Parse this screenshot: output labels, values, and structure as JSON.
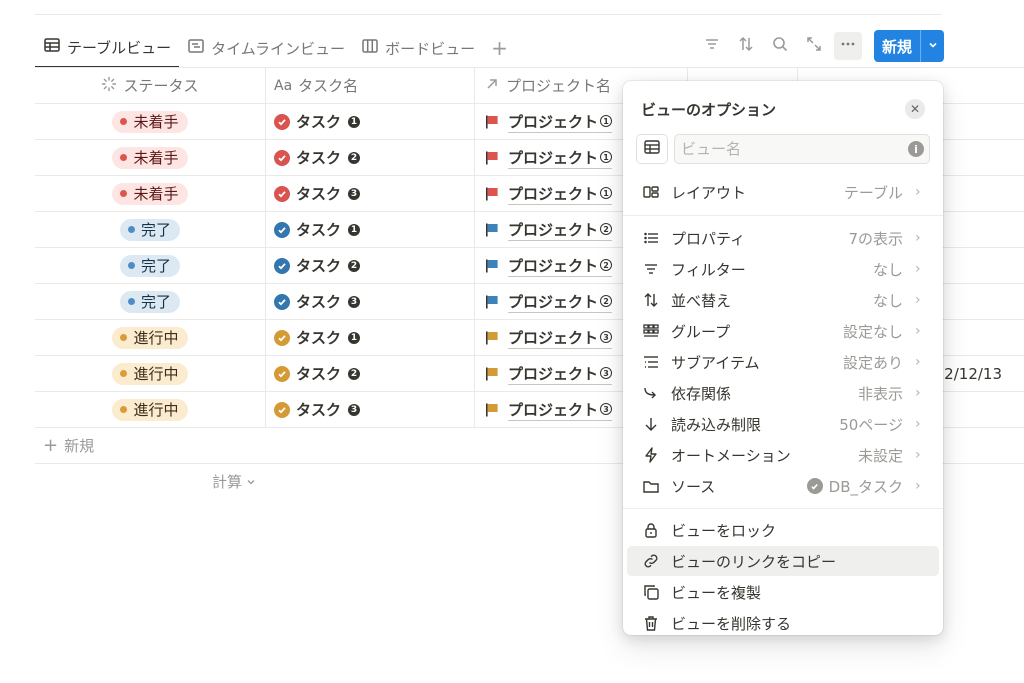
{
  "tabs": [
    {
      "label": "テーブルビュー",
      "icon": "table-icon",
      "active": true
    },
    {
      "label": "タイムラインビュー",
      "icon": "timeline-icon",
      "active": false
    },
    {
      "label": "ボードビュー",
      "icon": "board-icon",
      "active": false
    }
  ],
  "tab_add": "+",
  "toolbar": {
    "icons": [
      "filter-icon",
      "sort-icon",
      "search-icon",
      "expand-icon",
      "more-icon"
    ],
    "new_label": "新規"
  },
  "columns": {
    "status": "ステータス",
    "task_prefix": "Aa",
    "task": "タスク名",
    "project": "プロジェクト名"
  },
  "rows": [
    {
      "status": "未着手",
      "status_color": "red",
      "task": "タスク",
      "task_num": "1",
      "project": "プロジェクト",
      "project_num": "1",
      "project_color": "#de5550"
    },
    {
      "status": "未着手",
      "status_color": "red",
      "task": "タスク",
      "task_num": "2",
      "project": "プロジェクト",
      "project_num": "1",
      "project_color": "#de5550"
    },
    {
      "status": "未着手",
      "status_color": "red",
      "task": "タスク",
      "task_num": "3",
      "project": "プロジェクト",
      "project_num": "1",
      "project_color": "#de5550"
    },
    {
      "status": "完了",
      "status_color": "blue",
      "task": "タスク",
      "task_num": "1",
      "project": "プロジェクト",
      "project_num": "2",
      "project_color": "#3f82b8"
    },
    {
      "status": "完了",
      "status_color": "blue",
      "task": "タスク",
      "task_num": "2",
      "project": "プロジェクト",
      "project_num": "2",
      "project_color": "#3f82b8"
    },
    {
      "status": "完了",
      "status_color": "blue",
      "task": "タスク",
      "task_num": "3",
      "project": "プロジェクト",
      "project_num": "2",
      "project_color": "#3f82b8"
    },
    {
      "status": "進行中",
      "status_color": "yellow",
      "task": "タスク",
      "task_num": "1",
      "project": "プロジェクト",
      "project_num": "3",
      "project_color": "#d39b36"
    },
    {
      "status": "進行中",
      "status_color": "yellow",
      "task": "タスク",
      "task_num": "2",
      "project": "プロジェクト",
      "project_num": "3",
      "project_color": "#d39b36",
      "date_fragment": "2/12/13"
    },
    {
      "status": "進行中",
      "status_color": "yellow",
      "task": "タスク",
      "task_num": "3",
      "project": "プロジェクト",
      "project_num": "3",
      "project_color": "#d39b36"
    }
  ],
  "add_row_label": "新規",
  "calc_label": "計算",
  "check_colors": {
    "red": "#d9534f",
    "blue": "#3476ae",
    "yellow": "#d49a33"
  },
  "popup": {
    "title": "ビューのオプション",
    "name_placeholder": "ビュー名",
    "items": [
      {
        "icon": "layout-icon",
        "label": "レイアウト",
        "value": "テーブル",
        "group": 1
      },
      {
        "icon": "list-icon",
        "label": "プロパティ",
        "value": "7の表示",
        "group": 2
      },
      {
        "icon": "filter-icon",
        "label": "フィルター",
        "value": "なし",
        "group": 2
      },
      {
        "icon": "sort-icon",
        "label": "並べ替え",
        "value": "なし",
        "group": 2
      },
      {
        "icon": "group-icon",
        "label": "グループ",
        "value": "設定なし",
        "group": 2
      },
      {
        "icon": "subitem-icon",
        "label": "サブアイテム",
        "value": "設定あり",
        "group": 2
      },
      {
        "icon": "dependency-icon",
        "label": "依存関係",
        "value": "非表示",
        "group": 2
      },
      {
        "icon": "arrow-down-icon",
        "label": "読み込み制限",
        "value": "50ページ",
        "group": 2
      },
      {
        "icon": "lightning-icon",
        "label": "オートメーション",
        "value": "未設定",
        "group": 2
      },
      {
        "icon": "folder-icon",
        "label": "ソース",
        "value": "DB_タスク",
        "group": 2
      },
      {
        "icon": "lock-icon",
        "label": "ビューをロック",
        "value": "",
        "group": 3
      },
      {
        "icon": "link-icon",
        "label": "ビューのリンクをコピー",
        "value": "",
        "group": 3,
        "hover": true
      },
      {
        "icon": "duplicate-icon",
        "label": "ビューを複製",
        "value": "",
        "group": 3
      },
      {
        "icon": "trash-icon",
        "label": "ビューを削除する",
        "value": "",
        "group": 3
      }
    ]
  }
}
